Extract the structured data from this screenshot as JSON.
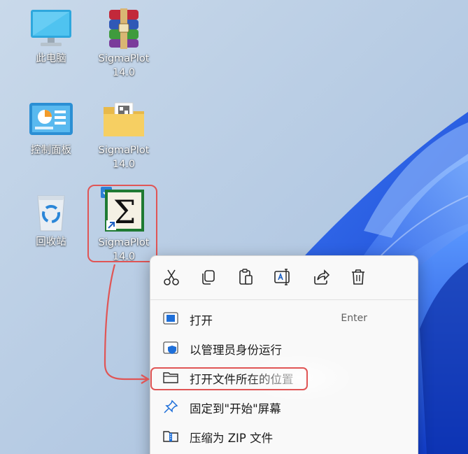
{
  "desktop": {
    "icons": [
      {
        "id": "this-pc",
        "label": "此电脑"
      },
      {
        "id": "sp-rar",
        "label": "SigmaPlot\n14.0"
      },
      {
        "id": "control-panel",
        "label": "控制面板"
      },
      {
        "id": "sp-folder",
        "label": "SigmaPlot\n14.0"
      },
      {
        "id": "recycle-bin",
        "label": "回收站"
      },
      {
        "id": "sp-shortcut",
        "label": "SigmaPlot\n14.0",
        "selected": true
      }
    ]
  },
  "context_menu": {
    "quick_actions": [
      "cut-icon",
      "copy-icon",
      "paste-icon",
      "rename-icon",
      "share-icon",
      "delete-icon"
    ],
    "items": [
      {
        "label": "打开",
        "shortcut": "Enter",
        "icon": "open-app-icon"
      },
      {
        "label": "以管理员身份运行",
        "icon": "admin-shield-icon"
      },
      {
        "label": "打开文件所在的位置",
        "icon": "folder-icon",
        "highlighted": true
      },
      {
        "label": "固定到\"开始\"屏幕",
        "icon": "pin-icon"
      },
      {
        "label": "压缩为 ZIP 文件",
        "icon": "zip-icon"
      }
    ]
  },
  "colors": {
    "accent_red": "#e05555",
    "wallpaper_base": "#b7cde4",
    "wallpaper_bloom": "#1f5ee8",
    "menu_bg": "#f9f9f9"
  }
}
